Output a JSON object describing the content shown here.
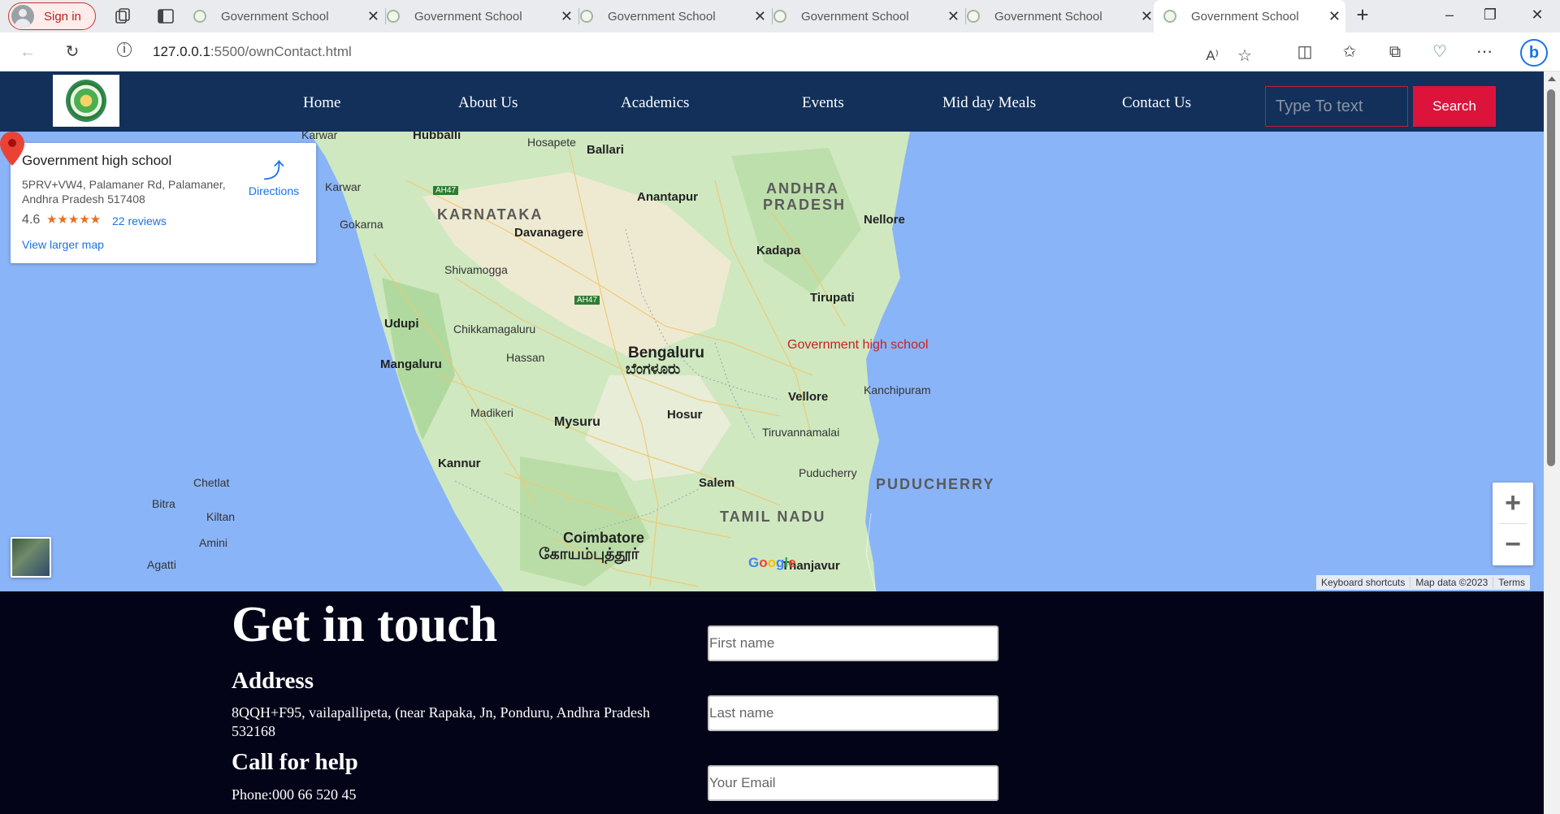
{
  "browser": {
    "signin_label": "Sign in",
    "tabs": [
      {
        "title": "Government School"
      },
      {
        "title": "Government School"
      },
      {
        "title": "Government School"
      },
      {
        "title": "Government School"
      },
      {
        "title": "Government School"
      },
      {
        "title": "Government School"
      }
    ],
    "active_tab_index": 5,
    "url_host": "127.0.0.1",
    "url_rest": ":5500/ownContact.html"
  },
  "header": {
    "nav": [
      {
        "label": "Home"
      },
      {
        "label": "About Us"
      },
      {
        "label": "Academics"
      },
      {
        "label": "Events"
      },
      {
        "label": "Mid day Meals"
      },
      {
        "label": "Contact Us"
      }
    ],
    "search_placeholder": "Type To text",
    "search_button": "Search",
    "accent_color": "#dc143c",
    "header_color": "#12305a"
  },
  "map": {
    "place_title": "Government high school",
    "place_address": "5PRV+VW4, Palamaner Rd, Palamaner, Andhra Pradesh 517408",
    "rating": "4.6",
    "stars": "★★★★★",
    "reviews": "22 reviews",
    "directions": "Directions",
    "view_larger": "View larger map",
    "pin_label": "Government high school",
    "google": "Google",
    "attribution": [
      "Keyboard shortcuts",
      "Map data ©2023",
      "Terms"
    ],
    "labels": {
      "karnataka": "KARNATAKA",
      "andhra": "ANDHRA",
      "pradesh": "PRADESH",
      "tamil_nadu": "TAMIL NADU",
      "puducherry_state": "PUDUCHERRY",
      "bengaluru": "Bengaluru",
      "bengaluru_kn": "ಬೆಂಗಳೂರು",
      "coimbatore": "Coimbatore",
      "coimbatore_ta": "கோயம்புத்தூர்",
      "hubballi": "Hubballi",
      "hosapete": "Hosapete",
      "ballari": "Ballari",
      "anantapur": "Anantapur",
      "nellore": "Nellore",
      "kadapa": "Kadapa",
      "tirupati": "Tirupati",
      "karwar": "Karwar",
      "gokarna": "Gokarna",
      "davanagere": "Davanagere",
      "shivamogga": "Shivamogga",
      "udupi": "Udupi",
      "chikkamagaluru": "Chikkamagaluru",
      "hassan": "Hassan",
      "mangaluru": "Mangaluru",
      "madikeri": "Madikeri",
      "mysuru": "Mysuru",
      "hosur": "Hosur",
      "vellore": "Vellore",
      "kanchipuram": "Kanchipuram",
      "tiruvannamalai": "Tiruvannamalai",
      "puducherry": "Puducherry",
      "salem": "Salem",
      "kannur": "Kannur",
      "chetlat": "Chetlat",
      "bitra": "Bitra",
      "kiltan": "Kiltan",
      "amini": "Amini",
      "agatti": "Agatti",
      "thanjavur": "Thanjavur",
      "ah47": "AH47"
    }
  },
  "contact": {
    "heading": "Get in touch",
    "address_heading": "Address",
    "address_text": "8QQH+F95, vailapallipeta, (near Rapaka, Jn, Ponduru, Andhra Pradesh 532168",
    "call_heading": "Call for help",
    "phone": "Phone:000 66 520 45",
    "fields": {
      "first_name": "First name",
      "last_name": "Last name",
      "email": "Your Email"
    }
  }
}
